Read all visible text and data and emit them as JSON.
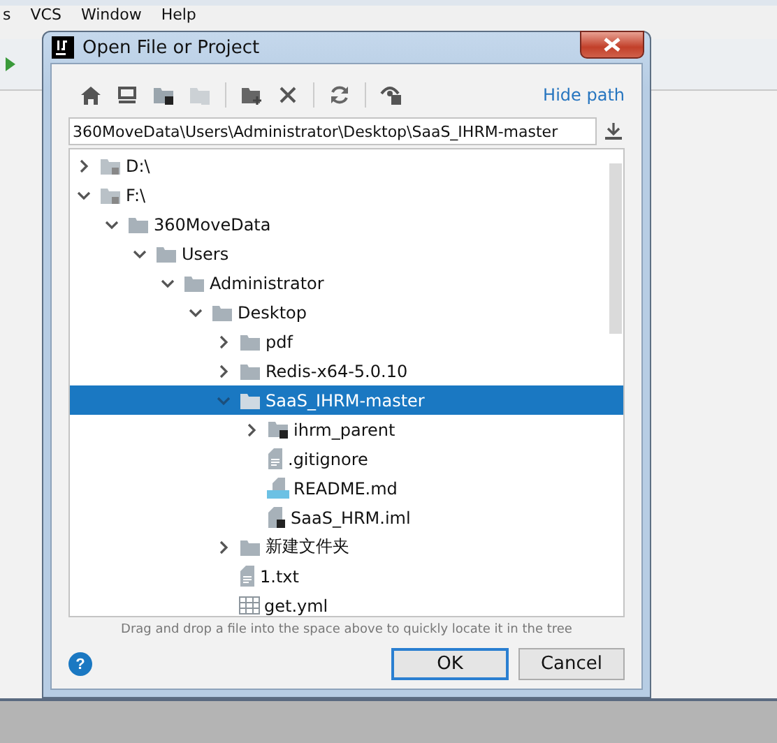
{
  "ide": {
    "menu": [
      "s",
      "VCS",
      "Window",
      "Help"
    ]
  },
  "dialog": {
    "title": "Open File or Project",
    "hide_path": "Hide path",
    "path": "360MoveData\\Users\\Administrator\\Desktop\\SaaS_IHRM-master",
    "tree": [
      {
        "label": "D:\\",
        "kind": "drive",
        "expanded": false,
        "selected": false
      },
      {
        "label": "F:\\",
        "kind": "drive",
        "expanded": true,
        "selected": false,
        "children": [
          {
            "label": "360MoveData",
            "kind": "folder",
            "expanded": true,
            "selected": false,
            "children": [
              {
                "label": "Users",
                "kind": "folder",
                "expanded": true,
                "selected": false,
                "children": [
                  {
                    "label": "Administrator",
                    "kind": "folder",
                    "expanded": true,
                    "selected": false,
                    "children": [
                      {
                        "label": "Desktop",
                        "kind": "folder",
                        "expanded": true,
                        "selected": false,
                        "children": [
                          {
                            "label": "pdf",
                            "kind": "folder",
                            "expanded": false,
                            "selected": false
                          },
                          {
                            "label": "Redis-x64-5.0.10",
                            "kind": "folder",
                            "expanded": false,
                            "selected": false
                          },
                          {
                            "label": "SaaS_IHRM-master",
                            "kind": "folder",
                            "expanded": true,
                            "selected": true,
                            "children": [
                              {
                                "label": "ihrm_parent",
                                "kind": "module",
                                "expanded": false,
                                "selected": false
                              },
                              {
                                "label": ".gitignore",
                                "kind": "text",
                                "selected": false
                              },
                              {
                                "label": "README.md",
                                "kind": "markdown",
                                "selected": false
                              },
                              {
                                "label": "SaaS_HRM.iml",
                                "kind": "iml",
                                "selected": false
                              }
                            ]
                          },
                          {
                            "label": "新建文件夹",
                            "kind": "folder",
                            "expanded": false,
                            "selected": false
                          },
                          {
                            "label": "1.txt",
                            "kind": "text",
                            "selected": false
                          },
                          {
                            "label": "get.yml",
                            "kind": "table",
                            "selected": false
                          }
                        ]
                      }
                    ]
                  }
                ]
              }
            ]
          }
        ]
      }
    ],
    "hint": "Drag and drop a file into the space above to quickly locate it in the tree",
    "help": "?",
    "buttons": [
      {
        "label": "OK",
        "default": true
      },
      {
        "label": "Cancel",
        "default": false
      }
    ]
  }
}
